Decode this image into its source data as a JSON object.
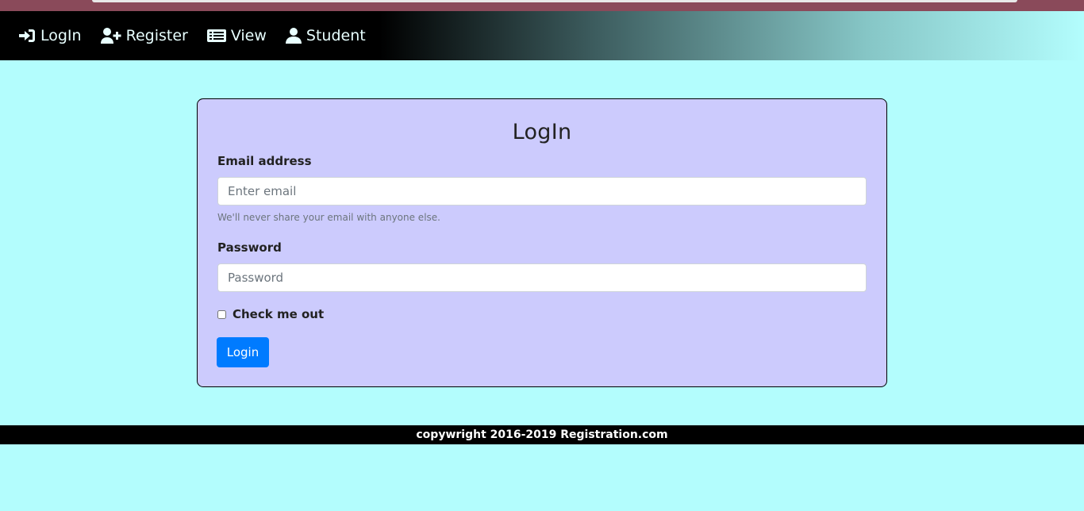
{
  "nav": {
    "items": [
      {
        "label": "LogIn",
        "icon": "sign-in-icon"
      },
      {
        "label": "Register",
        "icon": "user-plus-icon"
      },
      {
        "label": "View",
        "icon": "list-icon"
      },
      {
        "label": "Student",
        "icon": "user-icon"
      }
    ]
  },
  "form": {
    "title": "LogIn",
    "email_label": "Email address",
    "email_placeholder": "Enter email",
    "email_value": "",
    "email_help": "We'll never share your email with anyone else.",
    "password_label": "Password",
    "password_placeholder": "Password",
    "password_value": "",
    "remember_label": "Check me out",
    "remember_checked": false,
    "submit_label": "Login"
  },
  "footer": {
    "text": "copywright 2016-2019 Registration.com"
  },
  "colors": {
    "page_bg": "#b3fdfd",
    "card_bg": "#cccbfd",
    "button_bg": "#007bff",
    "footer_bg": "#000000"
  }
}
